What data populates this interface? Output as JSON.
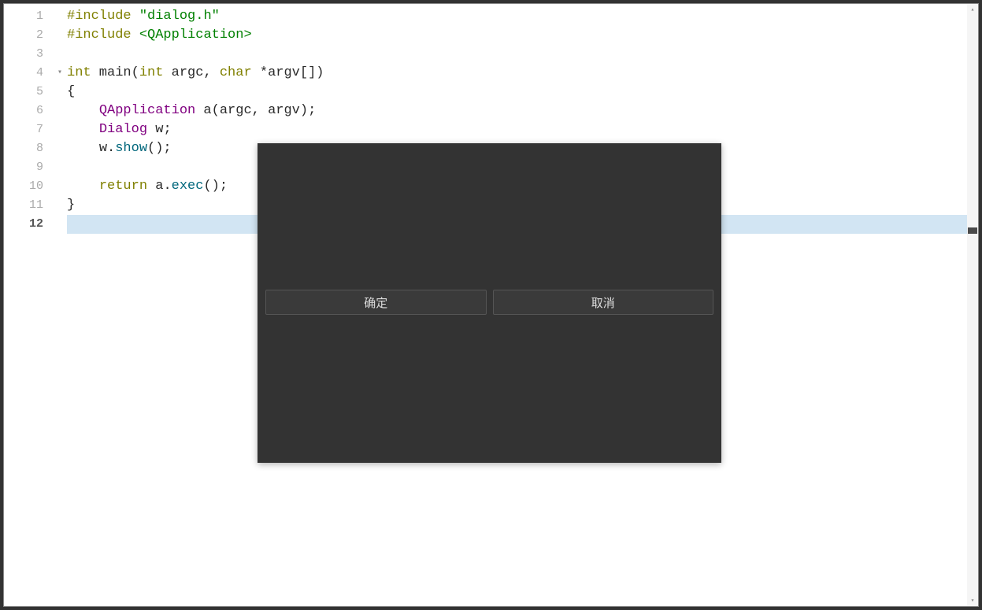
{
  "editor": {
    "lines": [
      {
        "num": "1",
        "fold": ""
      },
      {
        "num": "2",
        "fold": ""
      },
      {
        "num": "3",
        "fold": ""
      },
      {
        "num": "4",
        "fold": "▾"
      },
      {
        "num": "5",
        "fold": ""
      },
      {
        "num": "6",
        "fold": ""
      },
      {
        "num": "7",
        "fold": ""
      },
      {
        "num": "8",
        "fold": ""
      },
      {
        "num": "9",
        "fold": ""
      },
      {
        "num": "10",
        "fold": ""
      },
      {
        "num": "11",
        "fold": ""
      },
      {
        "num": "12",
        "fold": ""
      }
    ],
    "current_line": 12,
    "code": {
      "l1_include": "#include",
      "l1_string": " \"dialog.h\"",
      "l2_include": "#include",
      "l2_angle": " <QApplication>",
      "l4_type": "int",
      "l4_func": " main",
      "l4_paren_open": "(",
      "l4_type2": "int",
      "l4_var1": " argc",
      "l4_comma": ", ",
      "l4_type3": "char",
      "l4_star": " *",
      "l4_var2": "argv",
      "l4_brackets": "[])",
      "l5_brace": "{",
      "l6_indent": "    ",
      "l6_class": "QApplication",
      "l6_var": " a",
      "l6_paren": "(",
      "l6_arg1": "argc",
      "l6_comma": ", ",
      "l6_arg2": "argv",
      "l6_end": ");",
      "l7_indent": "    ",
      "l7_class": "Dialog",
      "l7_var": " w",
      "l7_end": ";",
      "l8_indent": "    ",
      "l8_var": "w",
      "l8_dot": ".",
      "l8_method": "show",
      "l8_end": "();",
      "l10_indent": "    ",
      "l10_return": "return",
      "l10_var": " a",
      "l10_dot": ".",
      "l10_method": "exec",
      "l10_end": "();",
      "l11_brace": "}"
    }
  },
  "dialog": {
    "ok_label": "确定",
    "cancel_label": "取消"
  }
}
